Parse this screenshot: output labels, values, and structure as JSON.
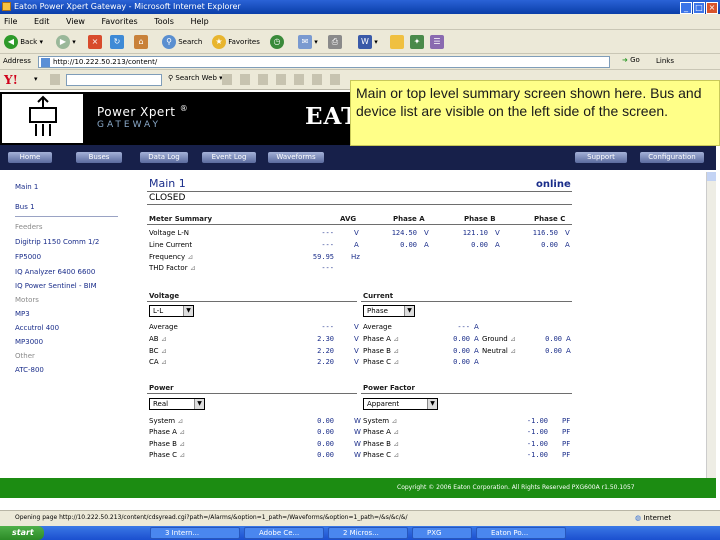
{
  "window": {
    "title": "Eaton Power Xpert Gateway - Microsoft Internet Explorer"
  },
  "menu": [
    "File",
    "Edit",
    "View",
    "Favorites",
    "Tools",
    "Help"
  ],
  "toolbar": {
    "back": "Back",
    "search": "Search",
    "favorites": "Favorites"
  },
  "address": {
    "label": "Address",
    "url": "http://10.222.50.213/content/",
    "go": "Go",
    "links": "Links"
  },
  "yahoo": {
    "logo": "Y!",
    "search_button": "Search Web"
  },
  "header": {
    "product": "Power Xpert",
    "reg": "®",
    "subtitle": "GATEWAY",
    "brand": "EAT"
  },
  "nav": {
    "left": [
      "Home",
      "Buses",
      "Data Log",
      "Event Log",
      "Waveforms"
    ],
    "right": [
      "Support",
      "Configuration"
    ]
  },
  "sidebar": {
    "items": [
      {
        "label": "Main 1",
        "muted": false
      },
      {
        "label": "Bus 1",
        "muted": false
      },
      {
        "label": "Feeders",
        "muted": true
      },
      {
        "label": "Digitrip 1150 Comm 1/2",
        "muted": false
      },
      {
        "label": "FP5000",
        "muted": false
      },
      {
        "label": "IQ Analyzer 6400 6600",
        "muted": false
      },
      {
        "label": "IQ Power Sentinel - BIM",
        "muted": false
      },
      {
        "label": "Motors",
        "muted": true
      },
      {
        "label": "MP3",
        "muted": false
      },
      {
        "label": "Accutrol 400",
        "muted": false
      },
      {
        "label": "MP3000",
        "muted": false
      },
      {
        "label": "Other",
        "muted": true
      },
      {
        "label": "ATC-800",
        "muted": false
      }
    ]
  },
  "main": {
    "title": "Main 1",
    "status": "online",
    "breaker": "CLOSED",
    "meter_summary": {
      "title": "Meter Summary",
      "cols": [
        "AVG",
        "Phase A",
        "Phase B",
        "Phase C"
      ],
      "rows": [
        {
          "label": "Voltage L-N",
          "avg": "---",
          "unit_avg": "V",
          "a": "124.50",
          "unit_a": "V",
          "b": "121.10",
          "unit_b": "V",
          "c": "116.50",
          "unit_c": "V"
        },
        {
          "label": "Line Current",
          "avg": "---",
          "unit_avg": "A",
          "a": "0.00",
          "unit_a": "A",
          "b": "0.00",
          "unit_b": "A",
          "c": "0.00",
          "unit_c": "A"
        },
        {
          "label": "Frequency",
          "avg": "59.95",
          "unit_avg": "Hz",
          "a": "",
          "unit_a": "",
          "b": "",
          "unit_b": "",
          "c": "",
          "unit_c": ""
        },
        {
          "label": "THD Factor",
          "avg": "---",
          "unit_avg": "",
          "a": "",
          "unit_a": "",
          "b": "",
          "unit_b": "",
          "c": "",
          "unit_c": ""
        }
      ]
    },
    "voltage": {
      "title": "Voltage",
      "select": "L-L",
      "rows": [
        {
          "label": "Average",
          "value": "---",
          "unit": "V"
        },
        {
          "label": "AB",
          "value": "2.30",
          "unit": "V"
        },
        {
          "label": "BC",
          "value": "2.20",
          "unit": "V"
        },
        {
          "label": "CA",
          "value": "2.20",
          "unit": "V"
        }
      ]
    },
    "current": {
      "title": "Current",
      "select": "Phase",
      "rows": [
        {
          "label": "Average",
          "value": "---",
          "unit": "A",
          "label2": "",
          "value2": "",
          "unit2": ""
        },
        {
          "label": "Phase A",
          "value": "0.00",
          "unit": "A",
          "label2": "Ground",
          "value2": "0.00",
          "unit2": "A"
        },
        {
          "label": "Phase B",
          "value": "0.00",
          "unit": "A",
          "label2": "Neutral",
          "value2": "0.00",
          "unit2": "A"
        },
        {
          "label": "Phase C",
          "value": "0.00",
          "unit": "A",
          "label2": "",
          "value2": "",
          "unit2": ""
        }
      ]
    },
    "power": {
      "title": "Power",
      "select": "Real",
      "rows": [
        {
          "label": "System",
          "value": "0.00",
          "unit": "W"
        },
        {
          "label": "Phase A",
          "value": "0.00",
          "unit": "W"
        },
        {
          "label": "Phase B",
          "value": "0.00",
          "unit": "W"
        },
        {
          "label": "Phase C",
          "value": "0.00",
          "unit": "W"
        }
      ]
    },
    "power_factor": {
      "title": "Power Factor",
      "select": "Apparent",
      "rows": [
        {
          "label": "System",
          "value": "-1.00",
          "unit": "PF"
        },
        {
          "label": "Phase A",
          "value": "-1.00",
          "unit": "PF"
        },
        {
          "label": "Phase B",
          "value": "-1.00",
          "unit": "PF"
        },
        {
          "label": "Phase C",
          "value": "-1.00",
          "unit": "PF"
        }
      ]
    }
  },
  "footer": {
    "copyright": "Copyright © 2006 Eaton Corporation. All Rights Reserved PXG600A r1.50.1057"
  },
  "status": {
    "text": "Opening page http://10.222.50.213/content/cdsyread.cgi?path=/Alarms/&option=1_path=/Waveforms/&option=1_path=/&s/&c/&/",
    "zone": "Internet"
  },
  "taskbar": {
    "start": "start",
    "tasks": [
      "3 Intern...",
      "Adobe Ce...",
      "2 Micros...",
      "PXG",
      "Eaton Po..."
    ]
  },
  "tooltip": {
    "text": "Main or top level summary screen shown here. Bus and device list are visible on the left side of the screen."
  },
  "colors": {
    "nav_bg": "#17204a",
    "footer": "#1c8c12",
    "tooltip": "#ffff88",
    "link": "#1a2d8a"
  }
}
